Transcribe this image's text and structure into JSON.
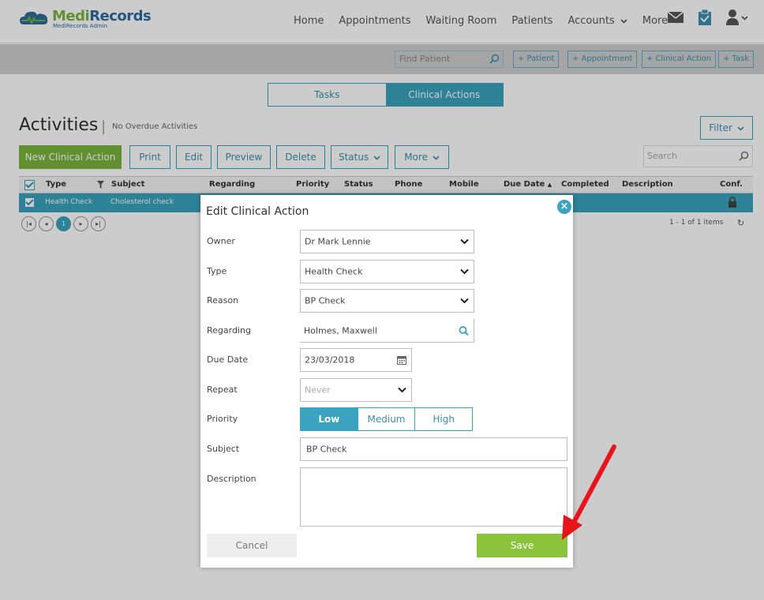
{
  "brand": {
    "title_part1": "Medi",
    "title_part2": "Records",
    "subtitle": "MediRecords Admin"
  },
  "nav": {
    "items": [
      {
        "label": "Home"
      },
      {
        "label": "Appointments"
      },
      {
        "label": "Waiting Room"
      },
      {
        "label": "Patients"
      },
      {
        "label": "Accounts",
        "has_caret": true
      },
      {
        "label": "More",
        "has_caret": true
      }
    ]
  },
  "toolbar": {
    "find_patient_placeholder": "Find Patient",
    "buttons": [
      "+ Patient",
      "+ Appointment",
      "+ Clinical Action",
      "+ Task"
    ]
  },
  "tabs": {
    "tasks": "Tasks",
    "clinical_actions": "Clinical Actions",
    "active": "clinical_actions"
  },
  "activities": {
    "title": "Activities",
    "subtitle": "No Overdue Activities",
    "filter_label": "Filter",
    "new_button": "New Clinical Action",
    "buttons": {
      "print": "Print",
      "edit": "Edit",
      "preview": "Preview",
      "delete": "Delete",
      "status": "Status",
      "more": "More"
    },
    "search_placeholder": "Search"
  },
  "grid": {
    "columns": [
      "Type",
      "Subject",
      "Regarding",
      "Priority",
      "Status",
      "Phone",
      "Mobile",
      "Due Date",
      "Completed",
      "Description",
      "Conf."
    ],
    "sort_indicator": "▲",
    "rows": [
      {
        "type": "Health Check",
        "subject": "Cholesterol check"
      }
    ],
    "pager": {
      "current_page": "1",
      "items_text": "1 - 1 of 1 items"
    }
  },
  "modal": {
    "title": "Edit Clinical Action",
    "fields": {
      "owner": {
        "label": "Owner",
        "value": "Dr Mark Lennie"
      },
      "type": {
        "label": "Type",
        "value": "Health Check"
      },
      "reason": {
        "label": "Reason",
        "value": "BP Check"
      },
      "regarding": {
        "label": "Regarding",
        "value": "Holmes, Maxwell"
      },
      "due_date": {
        "label": "Due Date",
        "value": "23/03/2018"
      },
      "repeat": {
        "label": "Repeat",
        "placeholder": "Never"
      },
      "priority": {
        "label": "Priority",
        "options": [
          "Low",
          "Medium",
          "High"
        ],
        "selected": "Low"
      },
      "subject": {
        "label": "Subject",
        "value": "BP Check"
      },
      "description": {
        "label": "Description",
        "value": ""
      }
    },
    "cancel_label": "Cancel",
    "save_label": "Save"
  },
  "colors": {
    "accent": "#3aa3bf",
    "brand_green": "#7bb33b",
    "save_green": "#8bc33a",
    "annotation_arrow": "#e8141c"
  }
}
